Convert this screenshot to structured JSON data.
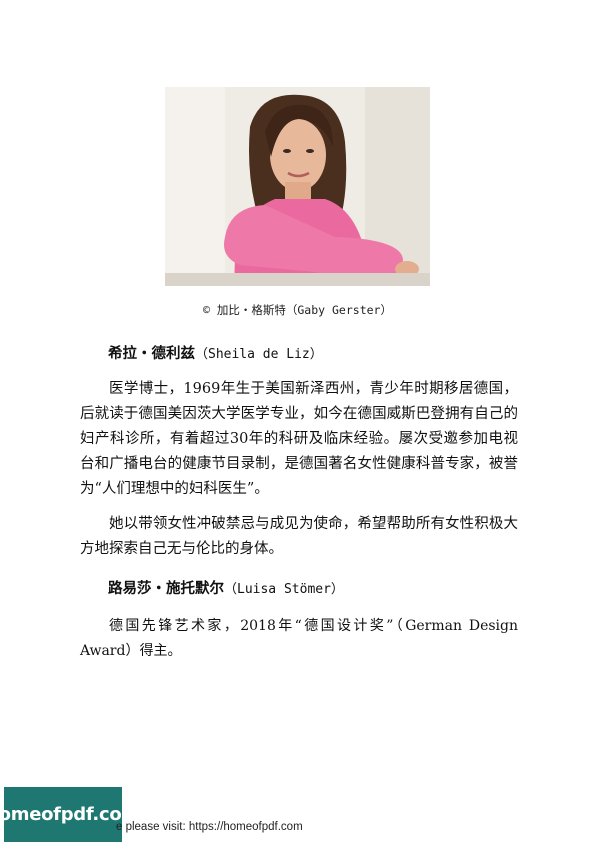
{
  "photo": {
    "alt": "portrait",
    "caption": "© 加比・格斯特（Gaby Gerster）"
  },
  "author1": {
    "name_cn": "希拉・德利兹",
    "name_latin": "（Sheila de Liz）",
    "paragraphs": [
      "医学博士，1969年生于美国新泽西州，青少年时期移居德国，后就读于德国美因茨大学医学专业，如今在德国威斯巴登拥有自己的妇产科诊所，有着超过30年的科研及临床经验。屡次受邀参加电视台和广播电台的健康节目录制，是德国著名女性健康科普专家，被誉为“人们理想中的妇科医生”。",
      "她以带领女性冲破禁忌与成见为使命，希望帮助所有女性积极大方地探索自己无与伦比的身体。"
    ]
  },
  "author2": {
    "name_cn": "路易莎・施托默尔",
    "name_latin": "（Luisa Stömer）",
    "paragraphs": [
      "德国先锋艺术家，2018年“德国设计奖”（German Design Award）得主。"
    ]
  },
  "footer": {
    "logo_text": "homeofpdf.com",
    "visit_text": "e please visit: https://homeofpdf.com"
  }
}
